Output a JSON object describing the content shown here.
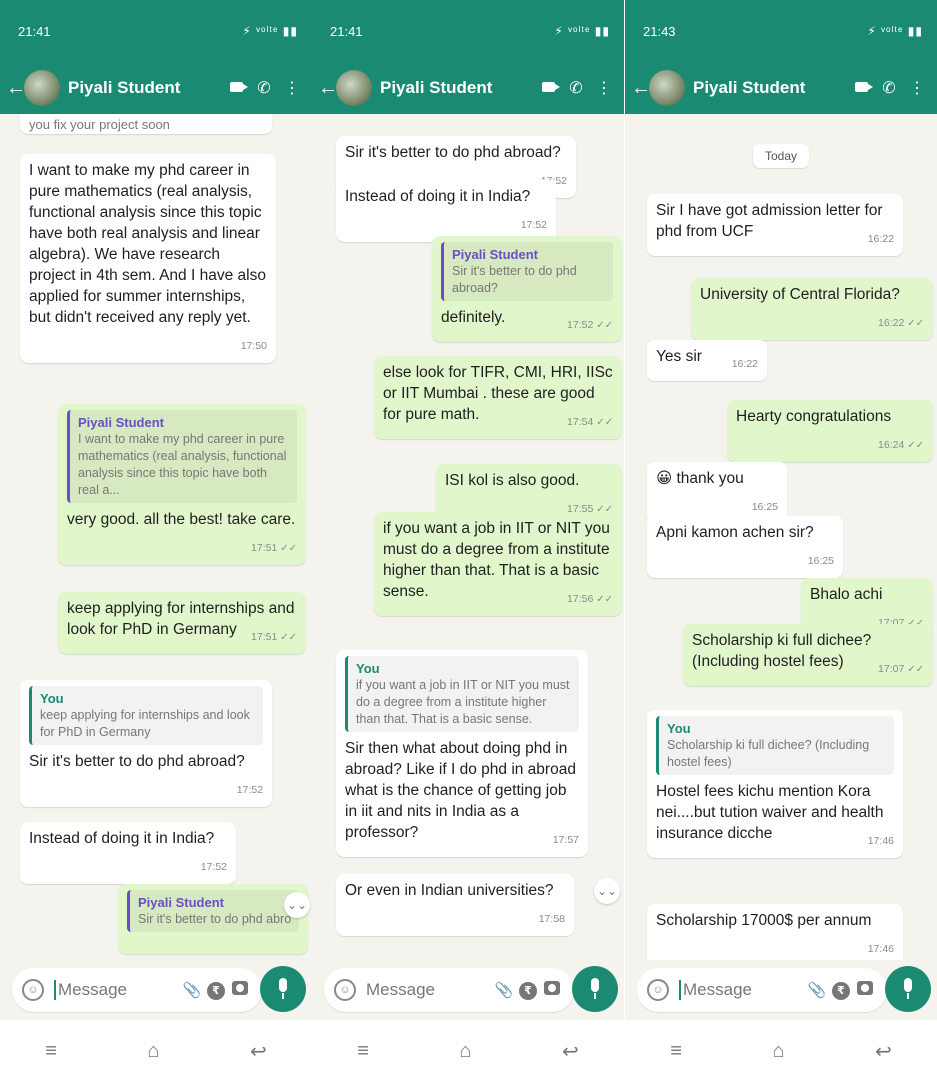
{
  "colors": {
    "accent": "#1b8a72",
    "outgoing_bubble": "#e2f6cc",
    "incoming_bubble": "#ffffff",
    "reply_bar_student": "#6a4fc4"
  },
  "contact_name": "Piyali Student",
  "input_placeholder": "Message",
  "screens": [
    {
      "status_time": "21:41",
      "status_right": "⚡ ᵛᵒˡᵗᵉ ▮▮",
      "messages": [
        {
          "text": "you fix your project soon",
          "time": "",
          "dir": "in"
        },
        {
          "text": "I want to make my phd career in pure mathematics (real analysis, functional analysis since this topic have both real analysis and linear algebra). We have research project in 4th sem. And I have also applied for summer internships, but didn't received any reply yet.",
          "time": "17:50",
          "dir": "in"
        },
        {
          "quote_name": "Piyali Student",
          "quote_text": "I want to make my phd career in pure mathematics (real analysis, functional analysis since this topic have both real a...",
          "text": "very good. all the best! take care.",
          "time": "17:51",
          "dir": "out"
        },
        {
          "text": "keep applying for internships and look for PhD in Germany",
          "time": "17:51",
          "dir": "out"
        },
        {
          "quote_name": "You",
          "quote_text": "keep applying for internships and look for PhD in Germany",
          "text": "Sir it's better to do phd abroad?",
          "time": "17:52",
          "dir": "in"
        },
        {
          "text": "Instead of doing it in India?",
          "time": "17:52",
          "dir": "in"
        },
        {
          "quote_name": "Piyali Student",
          "quote_text": "Sir it's better to do phd abroad?",
          "text": "",
          "time": "",
          "dir": "out"
        }
      ]
    },
    {
      "status_time": "21:41",
      "status_right": "⚡ ᵛᵒˡᵗᵉ ▮▮",
      "messages": [
        {
          "text": "Sir it's better to do phd abroad?",
          "time": "17:52",
          "dir": "in"
        },
        {
          "text": "Instead of doing it in India?",
          "time": "17:52",
          "dir": "in"
        },
        {
          "quote_name": "Piyali Student",
          "quote_text": "Sir it's better to do phd abroad?",
          "text": "definitely.",
          "time": "17:52",
          "dir": "out"
        },
        {
          "text": "else look for TIFR, CMI, HRI, IISc or IIT Mumbai . these are good for pure math.",
          "time": "17:54",
          "dir": "out"
        },
        {
          "text": "ISI kol is also good.",
          "time": "17:55",
          "dir": "out"
        },
        {
          "text": "if you want a job in IIT or NIT you must do a degree from a institute higher than that. That is a basic sense.",
          "time": "17:56",
          "dir": "out"
        },
        {
          "quote_name": "You",
          "quote_text": "if you want a job in IIT or NIT you must do a degree from a institute higher than that. That is a basic sense.",
          "text": "Sir then what about doing phd in abroad? Like if I do phd in abroad what is the chance of getting job in iit and nits in India as a professor?",
          "time": "17:57",
          "dir": "in"
        },
        {
          "text": "Or even in Indian universities?",
          "time": "17:58",
          "dir": "in"
        }
      ]
    },
    {
      "status_time": "21:43",
      "status_right": "⚡ ᵛᵒˡᵗᵉ ▮▮",
      "date_label": "Today",
      "messages": [
        {
          "text": "Sir I have got admission letter for phd from UCF",
          "time": "16:22",
          "dir": "in"
        },
        {
          "text": "University of Central Florida?",
          "time": "16:22",
          "dir": "out"
        },
        {
          "text": "Yes sir",
          "time": "16:22",
          "dir": "in"
        },
        {
          "text": "Hearty congratulations",
          "time": "16:24",
          "dir": "out"
        },
        {
          "text": "thank you",
          "time": "16:25",
          "dir": "in",
          "emoji": "😀"
        },
        {
          "text": "Apni kamon achen sir?",
          "time": "16:25",
          "dir": "in"
        },
        {
          "text": "Bhalo achi",
          "time": "17:07",
          "dir": "out"
        },
        {
          "text": "Scholarship ki full dichee? (Including hostel fees)",
          "time": "17:07",
          "dir": "out"
        },
        {
          "quote_name": "You",
          "quote_text": "Scholarship ki full dichee? (Including hostel fees)",
          "text": "Hostel fees kichu mention Kora nei....but tution waiver and health insurance dicche",
          "time": "17:46",
          "dir": "in"
        },
        {
          "text": "Scholarship 17000$ per annum",
          "time": "17:46",
          "dir": "in"
        }
      ]
    }
  ]
}
